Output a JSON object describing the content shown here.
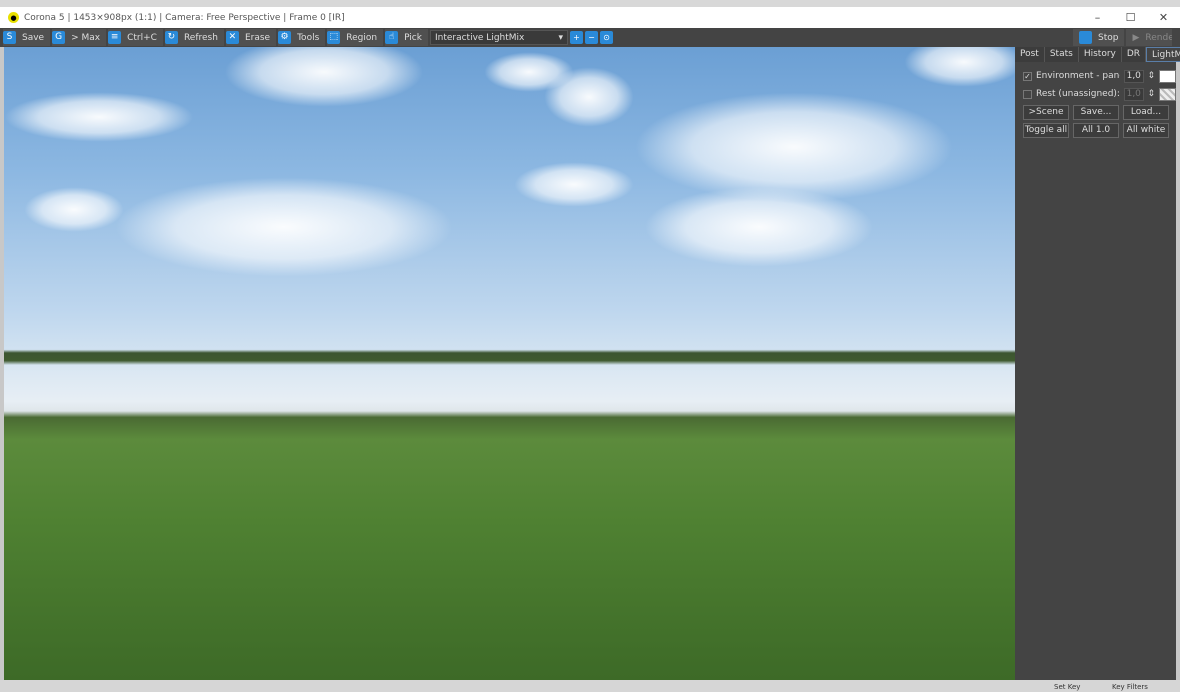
{
  "window": {
    "title": "Corona 5 | 1453×908px (1:1) | Camera: Free Perspective | Frame 0 [IR]",
    "minimize": "–",
    "maximize": "☐",
    "close": "✕"
  },
  "toolbar": {
    "buttons": [
      {
        "label": "Save",
        "icon": "S"
      },
      {
        "label": "> Max",
        "icon": "G"
      },
      {
        "label": "Ctrl+C",
        "icon": "≡"
      },
      {
        "label": "Refresh",
        "icon": "↻"
      },
      {
        "label": "Erase",
        "icon": "✕"
      },
      {
        "label": "Tools",
        "icon": "⚙"
      },
      {
        "label": "Region",
        "icon": "⬚"
      },
      {
        "label": "Pick",
        "icon": "☝"
      }
    ],
    "mode": "Interactive LightMix",
    "stop": "Stop",
    "render": "Render"
  },
  "panel": {
    "tabs": [
      "Post",
      "Stats",
      "History",
      "DR",
      "LightMix"
    ],
    "lights": [
      {
        "name": "Environment - panora",
        "checked": true,
        "value": "1,0"
      },
      {
        "name": "Rest (unassigned):",
        "checked": false,
        "value": "1,0"
      }
    ],
    "buttons1": [
      ">Scene",
      "Save...",
      "Load..."
    ],
    "buttons2": [
      "Toggle all",
      "All 1.0",
      "All white"
    ]
  },
  "bottom": {
    "set_key": "Set Key",
    "key_filters": "Key Filters"
  }
}
